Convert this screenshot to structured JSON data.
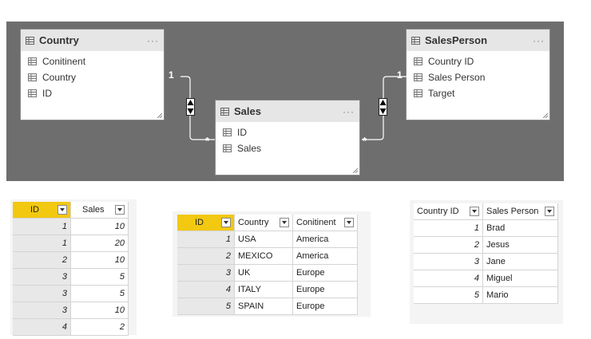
{
  "diagram": {
    "tables": {
      "country": {
        "name": "Country",
        "more": "···",
        "fields": [
          "Conitinent",
          "Country",
          "ID"
        ]
      },
      "salesperson": {
        "name": "SalesPerson",
        "more": "···",
        "fields": [
          "Country ID",
          "Sales Person",
          "Target"
        ]
      },
      "sales": {
        "name": "Sales",
        "more": "···",
        "fields": [
          "ID",
          "Sales"
        ]
      }
    },
    "relationships": {
      "left": {
        "one": "1",
        "many": "*"
      },
      "right": {
        "one": "1",
        "many": "*"
      }
    }
  },
  "sales_grid": {
    "headers": [
      "ID",
      "Sales"
    ],
    "rows": [
      [
        "1",
        "10"
      ],
      [
        "1",
        "20"
      ],
      [
        "2",
        "10"
      ],
      [
        "3",
        "5"
      ],
      [
        "3",
        "5"
      ],
      [
        "3",
        "10"
      ],
      [
        "4",
        "2"
      ]
    ]
  },
  "country_grid": {
    "headers": [
      "ID",
      "Country",
      "Conitinent"
    ],
    "rows": [
      [
        "1",
        "USA",
        "America"
      ],
      [
        "2",
        "MEXICO",
        "America"
      ],
      [
        "3",
        "UK",
        "Europe"
      ],
      [
        "4",
        "ITALY",
        "Europe"
      ],
      [
        "5",
        "SPAIN",
        "Europe"
      ]
    ]
  },
  "salesperson_grid": {
    "headers": [
      "Country ID",
      "Sales Person"
    ],
    "rows": [
      [
        "1",
        "Brad"
      ],
      [
        "2",
        "Jesus"
      ],
      [
        "3",
        "Jane"
      ],
      [
        "4",
        "Miguel"
      ],
      [
        "5",
        "Mario"
      ]
    ]
  },
  "colors": {
    "canvas": "#6e6e6e",
    "selected_header": "#f2c811",
    "card_header": "#e6e6e6"
  }
}
